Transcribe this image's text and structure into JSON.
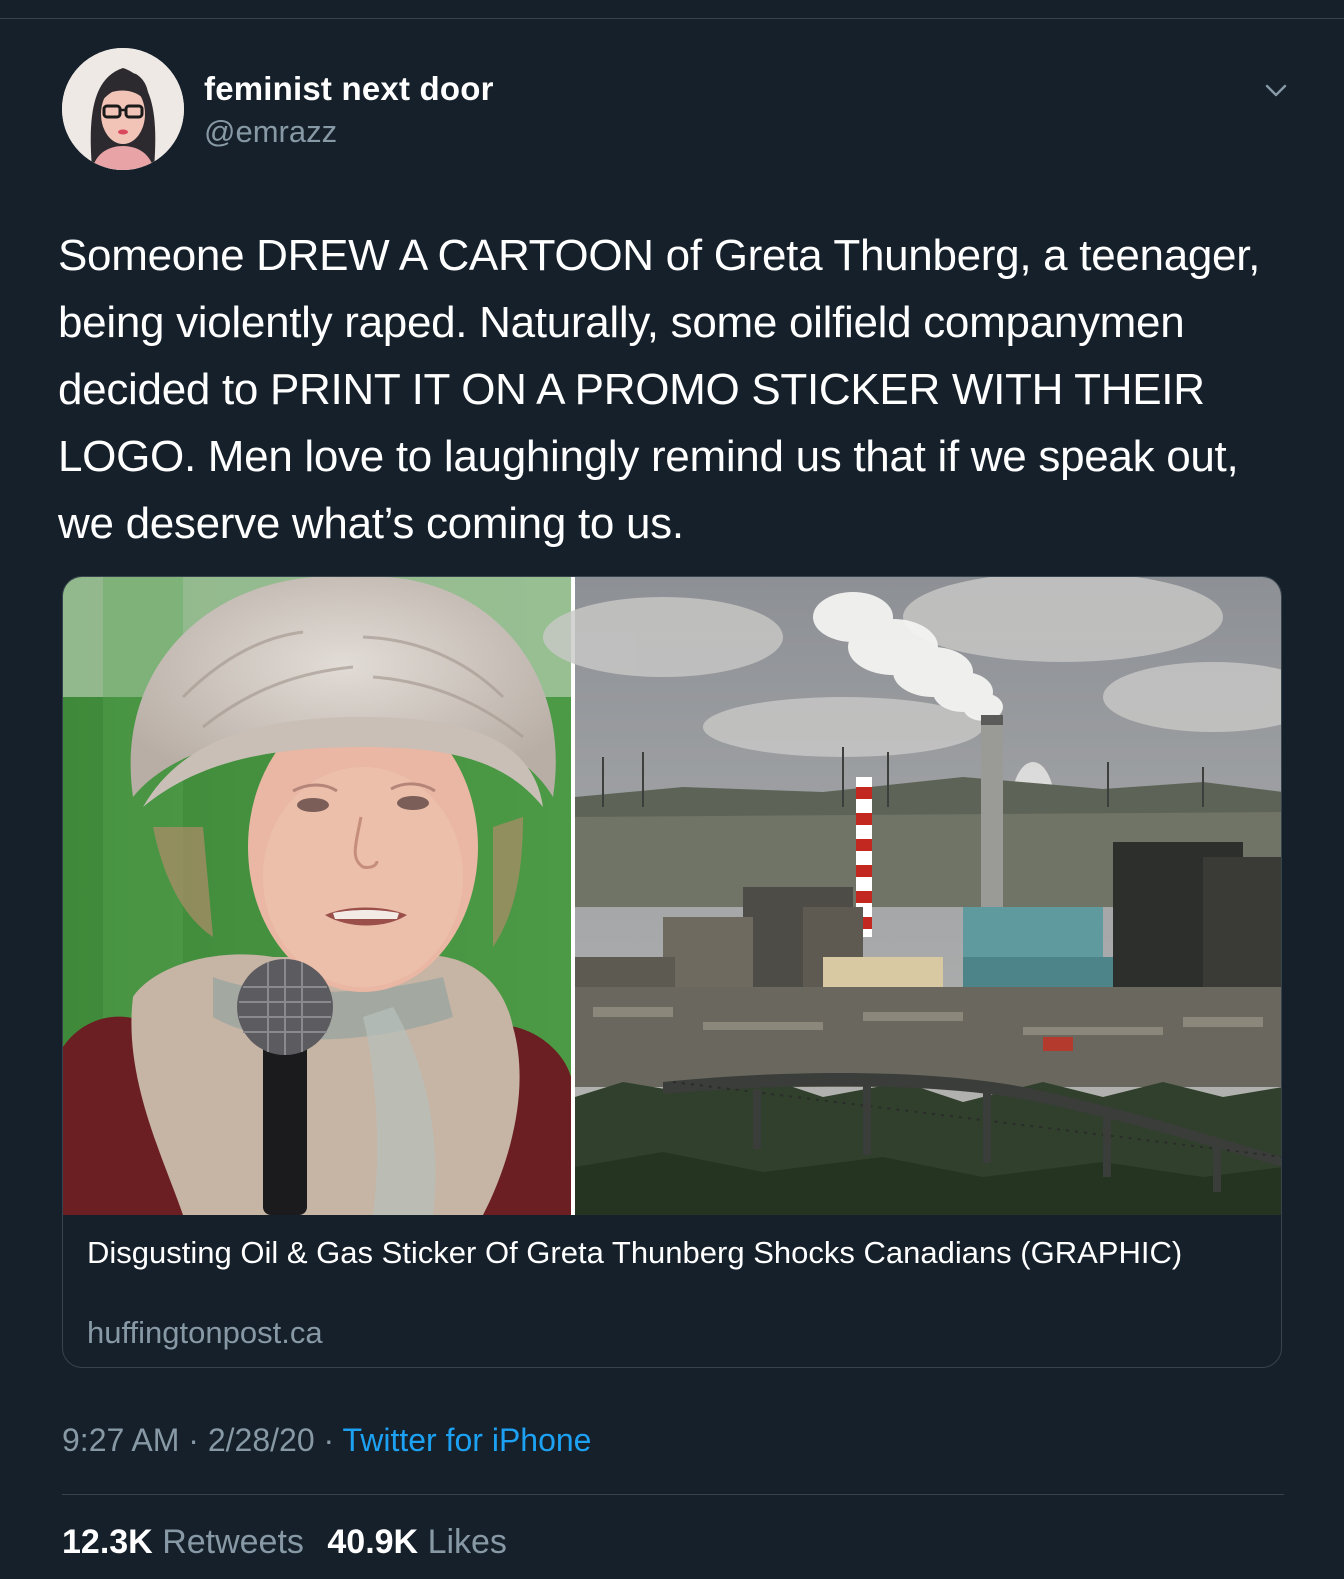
{
  "author": {
    "display_name": "feminist next door",
    "handle": "@emrazz"
  },
  "icons": {
    "menu": "chevron-down-icon",
    "avatar": "profile-photo"
  },
  "tweet": {
    "text": "Someone DREW A CARTOON of Greta Thunberg, a teenager, being violently raped. Naturally, some oilfield companymen decided to PRINT IT ON A PROMO STICKER WITH THEIR LOGO. Men love to laughingly remind us that if we speak out, we deserve what’s coming to us."
  },
  "link_card": {
    "title": "Disgusting Oil & Gas Sticker Of Greta Thunberg Shocks Canadians (GRAPHIC)",
    "domain": "huffingtonpost.ca"
  },
  "meta": {
    "time": "9:27 AM",
    "separator": "·",
    "date": "2/28/20",
    "source": "Twitter for iPhone"
  },
  "stats": {
    "retweets_count": "12.3K",
    "retweets_label": "Retweets",
    "likes_count": "40.9K",
    "likes_label": "Likes"
  },
  "colors": {
    "background": "#15202b",
    "secondary_text": "#8899a6",
    "link": "#1da1f2",
    "divider": "#38444d"
  }
}
